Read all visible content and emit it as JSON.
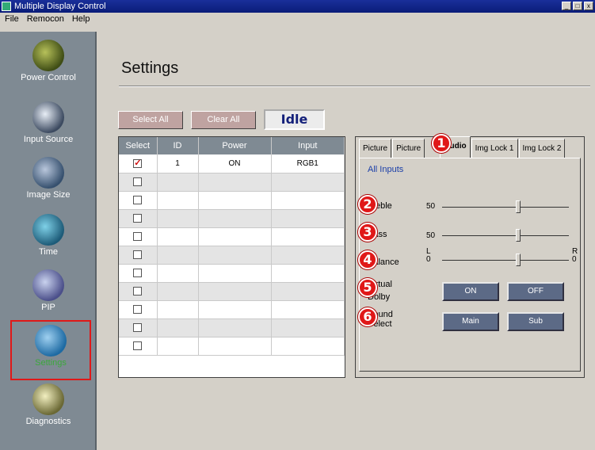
{
  "window": {
    "title": "Multiple Display Control",
    "buttons": [
      "_",
      "□",
      "x"
    ]
  },
  "menu": [
    "File",
    "Remocon",
    "Help"
  ],
  "sidebar": {
    "items": [
      {
        "label": "Power Control",
        "icon": "power-control-icon"
      },
      {
        "label": "Input Source",
        "icon": "input-source-icon"
      },
      {
        "label": "Image Size",
        "icon": "image-size-icon"
      },
      {
        "label": "Time",
        "icon": "time-icon"
      },
      {
        "label": "PIP",
        "icon": "pip-icon"
      },
      {
        "label": "Settings",
        "icon": "settings-icon",
        "selected": true
      },
      {
        "label": "Diagnostics",
        "icon": "diagnostics-icon"
      }
    ]
  },
  "page": {
    "title": "Settings"
  },
  "toolbar": {
    "select_all": "Select All",
    "clear_all": "Clear All",
    "status": "Idle"
  },
  "grid": {
    "headers": [
      "Select",
      "ID",
      "Power",
      "Input"
    ],
    "rows": [
      {
        "checked": true,
        "id": "1",
        "power": "ON",
        "input": "RGB1"
      },
      {
        "checked": false,
        "id": "",
        "power": "",
        "input": ""
      },
      {
        "checked": false,
        "id": "",
        "power": "",
        "input": ""
      },
      {
        "checked": false,
        "id": "",
        "power": "",
        "input": ""
      },
      {
        "checked": false,
        "id": "",
        "power": "",
        "input": ""
      },
      {
        "checked": false,
        "id": "",
        "power": "",
        "input": ""
      },
      {
        "checked": false,
        "id": "",
        "power": "",
        "input": ""
      },
      {
        "checked": false,
        "id": "",
        "power": "",
        "input": ""
      },
      {
        "checked": false,
        "id": "",
        "power": "",
        "input": ""
      },
      {
        "checked": false,
        "id": "",
        "power": "",
        "input": ""
      },
      {
        "checked": false,
        "id": "",
        "power": "",
        "input": ""
      }
    ]
  },
  "panel": {
    "tabs": [
      "Picture",
      "Picture",
      "Audio",
      "Img Lock 1",
      "Img Lock 2"
    ],
    "active_tab": "Audio",
    "subtitle": "All Inputs",
    "treble": {
      "label": "Treble",
      "value": "50",
      "level": 0.6
    },
    "bass": {
      "label": "Bass",
      "value": "50",
      "level": 0.6
    },
    "balance": {
      "label": "Balance",
      "left_label": "L",
      "right_label": "R",
      "left_value": "0",
      "right_value": "0",
      "level": 0.6
    },
    "virtual_dolby": {
      "label_line1": "Virtual",
      "label_line2": "Dolby",
      "on": "ON",
      "off": "OFF"
    },
    "sound_select": {
      "label_line1": "Sound",
      "label_line2": "Select",
      "main": "Main",
      "sub": "Sub"
    }
  },
  "badges": [
    "1",
    "2",
    "3",
    "4",
    "5",
    "6"
  ],
  "colors": {
    "badge": "#e01818",
    "highlight_border": "#e01818",
    "selected_label": "#3ba83b",
    "status_text": "#14207a"
  }
}
